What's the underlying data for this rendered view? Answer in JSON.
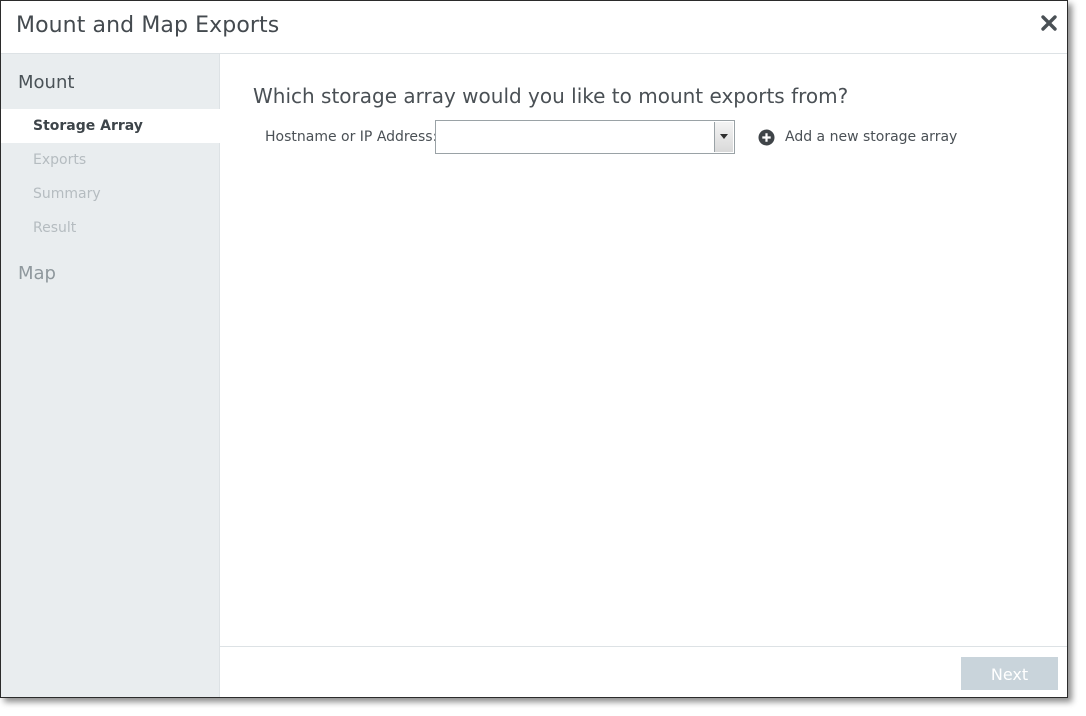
{
  "dialog": {
    "title": "Mount and Map Exports",
    "close_icon": "close-icon"
  },
  "sidebar": {
    "sections": [
      {
        "title": "Mount",
        "steps": [
          {
            "label": "Storage Array",
            "active": true
          },
          {
            "label": "Exports",
            "active": false
          },
          {
            "label": "Summary",
            "active": false
          },
          {
            "label": "Result",
            "active": false
          }
        ]
      },
      {
        "title": "Map",
        "steps": []
      }
    ]
  },
  "main": {
    "question": "Which storage array would you like to mount exports from?",
    "hostname_label": "Hostname or IP Address:",
    "hostname_value": "",
    "add_storage_label": "Add a new storage array",
    "add_icon": "plus-circle-icon"
  },
  "footer": {
    "next_label": "Next",
    "next_enabled": false
  }
}
